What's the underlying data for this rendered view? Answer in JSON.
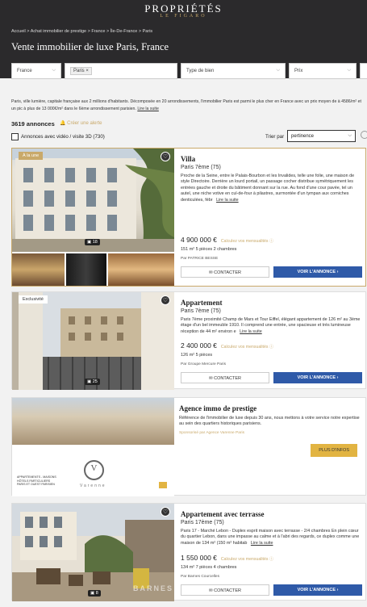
{
  "header": {
    "logo_line1": "PROPRIÉTÉS",
    "logo_line2": "LE FIGARO",
    "breadcrumb": "Accueil  >  Achat immobilier de prestige  >  France  >  Île-De-France  >  Paris",
    "title": "Vente immobilier de luxe Paris, France"
  },
  "filters": {
    "country": "France",
    "city_chip": "Paris",
    "city_chip_remove": "×",
    "type_placeholder": "Type de bien",
    "price_placeholder": "Prix",
    "chevron": "⌵"
  },
  "intro": {
    "text": "Paris, ville lumière, capitale française aux 2 millions d'habitants. Décomposée en 20 arrondissements, l'immobilier Paris est parmi le plus cher en France avec un prix moyen de à 4586/m² et un pic à plus de 13 000€/m² dans le 6ème arrondissement parisien.",
    "link": "Lire la suite"
  },
  "results": {
    "count": "3619 annonces",
    "alert": "🔔 Créer une alerte",
    "video_filter": "Annonces avec vidéo / visite 3D (730)",
    "sort_label": "Trier par",
    "sort_value": "pertinence"
  },
  "cards": [
    {
      "tag": "À la une",
      "title": "Villa",
      "location": "Paris 7ème (75)",
      "text": "Proche de la Seine, entre le Palais-Bourbon et les Invalides, telle une folie, une maison de style Directoire. Derrière un lourd portail, un passage cocher distribue symétriquement les entrées gauche et droite du bâtiment donnant sur la rue. Au fond d'une cour pavée, tel un autel, une niche votive en cul-de-four à pilastres, surmontée d'un tympan aux corniches denticulées, fébr",
      "more": "Lire la suite",
      "price": "4 900 000 €",
      "calc": "Calculez vos mensualités ⓘ",
      "specs": "151 m²     5 pièces     2 chambres",
      "agency": "Par PATRICE BESSE",
      "photos": "18",
      "contact": "CONTACTER",
      "view": "VOIR L'ANNONCE ›"
    },
    {
      "tag": "Exclusivité",
      "title": "Appartement",
      "location": "Paris 7ème (75)",
      "text": "Paris 7ème proximité Champ de Mars et Tour Eiffel, élégant appartement de 126 m² au 3ème étage d'un bel immeuble 1910. Il comprend une entrée, une spacieuse et très lumineuse réception de 44 m² environ e",
      "more": "Lire la suite",
      "price": "2 400 000 €",
      "calc": "Calculez vos mensualités ⓘ",
      "specs": "126 m²     5 pièces",
      "agency": "Par Groupe Mercure Paris",
      "photos": "25",
      "contact": "CONTACTER",
      "view": "VOIR L'ANNONCE ›"
    },
    {
      "title": "Agence immo de prestige",
      "text": "Référence de l'immobilier de luxe depuis 30 ans, nous mettons à votre service notre expertise au sein des quartiers historiques parisiens.",
      "sponsor": "Sponsorisé par Agence Varenne Paris",
      "cta": "PLUS D'INFOS",
      "ad_lines": "APPARTEMENTS - MAISONS\nHÔTELS PARTICULIERS\nPARIS ET OUEST PARISIEN",
      "brand": "Varenne",
      "monogram": "V"
    },
    {
      "title": "Appartement avec terrasse",
      "location": "Paris 17ème (75)",
      "text": "Paris 17 - Marché Lebon - Duplex esprit maison avec terrasse - 2/4 chambres En plein cœur du quartier Lebon, dans une impasse au calme et à l'abri des regards, ce duplex comme une maison de 134 m² (150 m² habitab",
      "more": "Lire la suite",
      "price": "1 550 000 €",
      "calc": "Calculez vos mensualités ⓘ",
      "specs": "134 m²     7 pièces     4 chambres",
      "agency": "Par Barnes Courcelles",
      "photos": "8",
      "contact": "CONTACTER",
      "view": "VOIR L'ANNONCE ›",
      "watermark": "BARNES"
    }
  ]
}
